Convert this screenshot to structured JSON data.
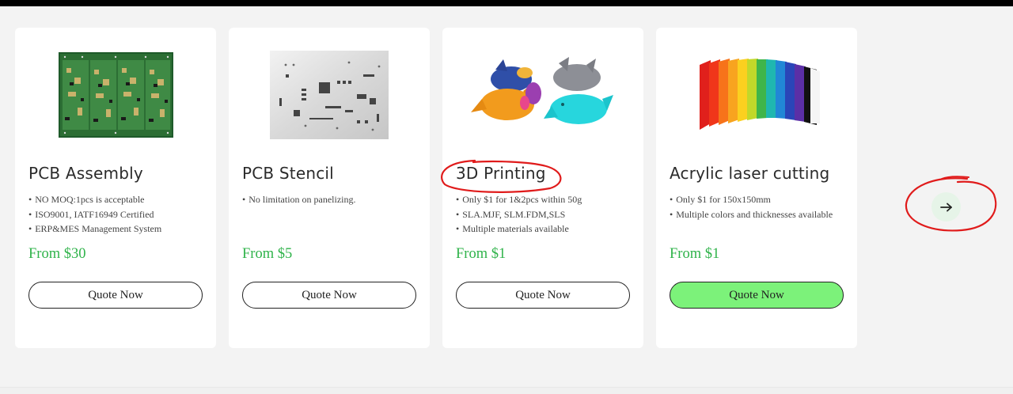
{
  "cards": [
    {
      "title": "PCB Assembly",
      "image": "pcb-board-image",
      "features": [
        "NO MOQ:1pcs is acceptable",
        "ISO9001, IATF16949 Certified",
        "ERP&MES Management System"
      ],
      "price": "From $30",
      "button": "Quote Now"
    },
    {
      "title": "PCB Stencil",
      "image": "pcb-stencil-image",
      "features": [
        "No limitation on panelizing."
      ],
      "price": "From $5",
      "button": "Quote Now"
    },
    {
      "title": "3D Printing",
      "image": "3d-printed-dragons-image",
      "features": [
        "Only $1 for 1&2pcs within 50g",
        "SLA.MJF, SLM.FDM,SLS",
        "Multiple materials available"
      ],
      "price": "From $1",
      "button": "Quote Now"
    },
    {
      "title": "Acrylic laser cutting",
      "image": "acrylic-sheets-image",
      "features": [
        "Only $1 for 150x150mm",
        "Multiple colors and thicknesses available"
      ],
      "price": "From $1",
      "button": "Quote Now"
    }
  ],
  "carousel": {
    "next_icon": "arrow-right-icon",
    "next_symbol": "→"
  },
  "colors": {
    "price_green": "#2fb34a",
    "active_button": "#7cf27a",
    "annotation_red": "#e01b1b"
  }
}
